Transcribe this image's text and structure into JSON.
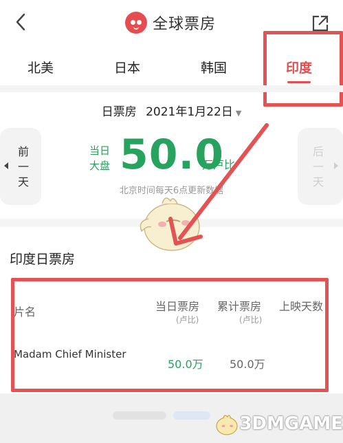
{
  "app": {
    "title": "全球票房"
  },
  "tabs": [
    {
      "label": "北美"
    },
    {
      "label": "日本"
    },
    {
      "label": "韩国"
    },
    {
      "label": "印度"
    }
  ],
  "active_tab": "印度",
  "daily": {
    "date_prefix": "日票房",
    "date": "2021年1月22日",
    "prev_label_1": "前",
    "prev_label_2": "一",
    "prev_label_3": "天",
    "next_label_1": "后",
    "next_label_2": "一",
    "next_label_3": "天",
    "gross_label_1": "当日",
    "gross_label_2": "大盘",
    "gross_value": "50.0",
    "gross_unit": "万卢比",
    "update_note": "北京时间每天6点更新数据"
  },
  "table": {
    "section_title": "印度日票房",
    "headers": {
      "film": "片名",
      "daily": "当日票房",
      "daily_unit": "(卢比)",
      "total": "累计票房",
      "total_unit": "(卢比)",
      "days": "上映天数"
    },
    "rows": [
      {
        "film": "Madam Chief Minister",
        "daily": "50.0万",
        "total": "50.0万"
      }
    ]
  },
  "watermark": {
    "text": "3DMGAME"
  },
  "colors": {
    "accent_red": "#e54d50",
    "green": "#27a35f",
    "annotation_red": "#e35353"
  }
}
